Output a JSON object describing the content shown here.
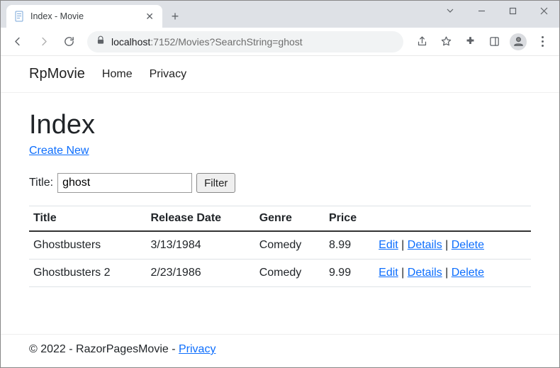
{
  "browser": {
    "tab_title": "Index - Movie",
    "url_host": "localhost",
    "url_port_path": ":7152/Movies?SearchString=ghost"
  },
  "nav": {
    "brand": "RpMovie",
    "home": "Home",
    "privacy": "Privacy"
  },
  "page": {
    "heading": "Index",
    "create_new": "Create New",
    "search_label": "Title:",
    "search_value": "ghost",
    "filter_label": "Filter"
  },
  "table": {
    "headers": {
      "title": "Title",
      "release_date": "Release Date",
      "genre": "Genre",
      "price": "Price",
      "actions": ""
    },
    "rows": [
      {
        "title": "Ghostbusters",
        "release_date": "3/13/1984",
        "genre": "Comedy",
        "price": "8.99"
      },
      {
        "title": "Ghostbusters 2",
        "release_date": "2/23/1986",
        "genre": "Comedy",
        "price": "9.99"
      }
    ],
    "actions": {
      "edit": "Edit",
      "details": "Details",
      "delete": "Delete"
    }
  },
  "footer": {
    "text": "© 2022 - RazorPagesMovie - ",
    "privacy": "Privacy"
  }
}
